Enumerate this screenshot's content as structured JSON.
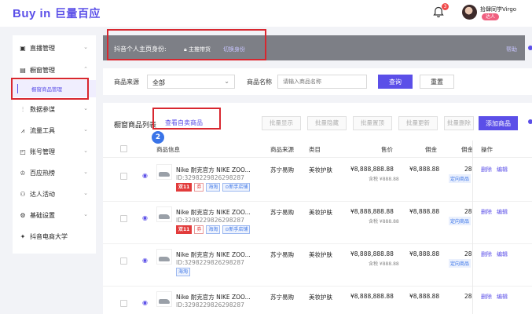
{
  "header": {
    "logo_en": "Buy in",
    "logo_cn": "巨量百应",
    "notification_count": "3",
    "username": "拾肆同学Virgo",
    "user_role": "达人"
  },
  "sidebar": {
    "items": [
      {
        "label": "直播管理",
        "icon": "live-icon"
      },
      {
        "label": "橱窗管理",
        "icon": "showcase-icon"
      },
      {
        "label": "数据参谋",
        "icon": "data-icon"
      },
      {
        "label": "流量工具",
        "icon": "traffic-icon"
      },
      {
        "label": "账号管理",
        "icon": "account-icon"
      },
      {
        "label": "百应热榜",
        "icon": "trophy-icon"
      },
      {
        "label": "达人活动",
        "icon": "activity-icon"
      },
      {
        "label": "基础设置",
        "icon": "settings-icon"
      },
      {
        "label": "抖音电商大学",
        "icon": "university-icon"
      }
    ],
    "active_sub": "橱窗商品管理"
  },
  "notice": {
    "title": "抖音个人主页身份:",
    "role": "主推带货",
    "switch_label": "切换身份",
    "help_label": "帮助"
  },
  "filter": {
    "source_label": "商品来源",
    "source_value": "全部",
    "name_label": "商品名称",
    "name_placeholder": "请输入商品名称",
    "query_label": "查询",
    "reset_label": "重置"
  },
  "list": {
    "title": "橱窗商品列表",
    "own_link": "查看自卖商品",
    "step_number": "2",
    "batch_buttons": [
      "批量显示",
      "批量隐藏",
      "批量置顶",
      "批量更新",
      "批量删除"
    ],
    "add_label": "添加商品",
    "columns": [
      "商品信息",
      "商品来源",
      "类目",
      "售价",
      "佣金",
      "佣金",
      "操作"
    ],
    "rows": [
      {
        "name": "Nike 耐克官方 NIKE ZOO...",
        "id": "ID:3298229826298287",
        "tags": [
          "双11",
          "券",
          "海淘",
          "新手店铺"
        ],
        "source": "苏宁易购",
        "category": "美妆护肤",
        "price": "¥8,888,888.88",
        "price_tax": "含税 ¥888.88",
        "commission": "¥8,888.88",
        "rate": "28",
        "rate_tag": "定向商品",
        "action_delete": "删除",
        "action_edit": "编辑"
      },
      {
        "name": "Nike 耐克官方 NIKE ZOO...",
        "id": "ID:3298229826298287",
        "tags": [
          "双11",
          "券",
          "海淘",
          "新手店铺"
        ],
        "source": "苏宁易购",
        "category": "美妆护肤",
        "price": "¥8,888,888.88",
        "price_tax": "含税 ¥888.88",
        "commission": "¥8,888.88",
        "rate": "28",
        "rate_tag": "定向商品",
        "action_delete": "删除",
        "action_edit": "编辑"
      },
      {
        "name": "Nike 耐克官方 NIKE ZOO...",
        "id": "ID:3298229826298287",
        "tags": [
          "海淘"
        ],
        "source": "苏宁易购",
        "category": "美妆护肤",
        "price": "¥8,888,888.88",
        "price_tax": "含税 ¥888.88",
        "commission": "¥8,888.88",
        "rate": "28",
        "rate_tag": "定向商品",
        "action_delete": "删除",
        "action_edit": "编辑"
      },
      {
        "name": "Nike 耐克官方 NIKE ZOO...",
        "id": "ID:3298229826298287",
        "tags": [],
        "source": "苏宁易购",
        "category": "美妆护肤",
        "price": "¥8,888,888.88",
        "price_tax": "",
        "commission": "¥8,888.88",
        "rate": "28",
        "rate_tag": "",
        "action_delete": "删除",
        "action_edit": "编辑"
      }
    ]
  },
  "colors": {
    "brand": "#5b4fe8",
    "highlight": "#d8272f",
    "tag_red": "#e23b3b",
    "tag_blue": "#3a74e8"
  }
}
